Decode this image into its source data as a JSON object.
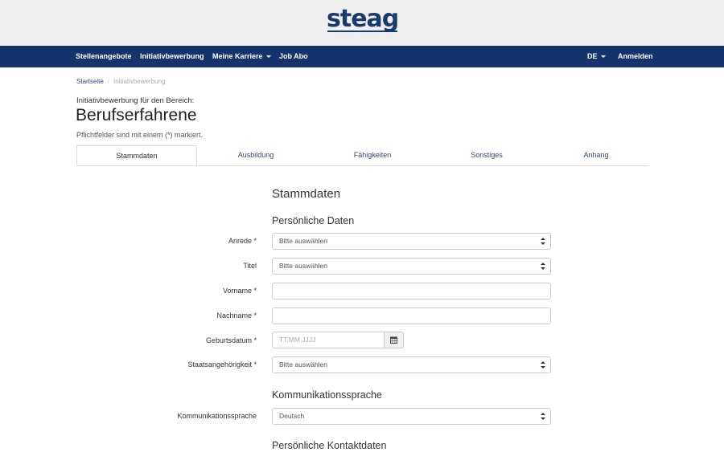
{
  "brand": {
    "logo_text": "steag"
  },
  "nav": {
    "items": [
      "Stellenangebote",
      "Initiativbewerbung",
      "Meine Karriere",
      "Job Abo"
    ],
    "language": "DE",
    "login": "Anmelden"
  },
  "breadcrumb": {
    "home": "Startseite",
    "current": "Initiativbewerbung"
  },
  "page": {
    "intro": "Initiativbewerbung für den Bereich:",
    "title": "Berufserfahrene",
    "required_note": "Pflichtfelder sind mit einem (*) markiert."
  },
  "tabs": [
    "Stammdaten",
    "Ausbildung",
    "Fähigkeiten",
    "Sonstiges",
    "Anhang"
  ],
  "form": {
    "heading": "Stammdaten",
    "personal_heading": "Persönliche Daten",
    "salutation_label": "Anrede *",
    "salutation_value": "Bitte auswählen",
    "title_label": "Titel",
    "title_value": "Bitte auswählen",
    "firstname_label": "Vorname *",
    "lastname_label": "Nachname *",
    "birthdate_label": "Geburtsdatum *",
    "birthdate_placeholder": "TT.MM.JJJJ",
    "nationality_label": "Staatsangehörigkeit *",
    "nationality_value": "Bitte auswählen",
    "comm_heading": "Kommunikationssprache",
    "comm_label": "Kommunikationssprache",
    "comm_value": "Deutsch",
    "contact_heading": "Persönliche Kontaktdaten"
  },
  "colors": {
    "brand": "#1a3a6e",
    "navbar": "#16346b",
    "link": "#2c4a7a"
  }
}
